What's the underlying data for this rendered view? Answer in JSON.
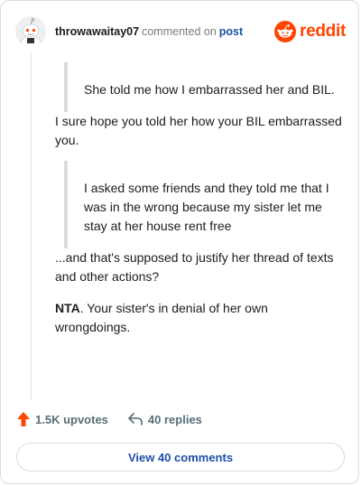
{
  "comment": {
    "username": "throwawaitay07",
    "action_text": "commented on",
    "post_link": "post"
  },
  "brand": {
    "wordmark": "reddit",
    "color": "#ff4500"
  },
  "body": {
    "quote_1": "She told me how I embarrassed her and BIL.",
    "para_1": "I sure hope you told her how your BIL embarrassed you.",
    "quote_2": "I asked some friends and they told me that I was in the wrong because my sister let me stay at her house rent free",
    "para_2": "...and that's supposed to justify her thread of texts and other actions?",
    "para_3_bold": "NTA",
    "para_3_rest": ". Your sister's in denial of her own wrongdoings."
  },
  "actions": {
    "upvotes": "1.5K upvotes",
    "replies": "40 replies"
  },
  "footer": {
    "view_button": "View 40 comments"
  },
  "icons": {
    "avatar": "snoo-avatar-icon",
    "logo": "reddit-logo-icon",
    "upvote": "upvote-arrow-icon",
    "reply": "reply-arrow-icon"
  },
  "colors": {
    "accent": "#ff4500",
    "link": "#1f4fa8",
    "muted": "#576f76"
  }
}
